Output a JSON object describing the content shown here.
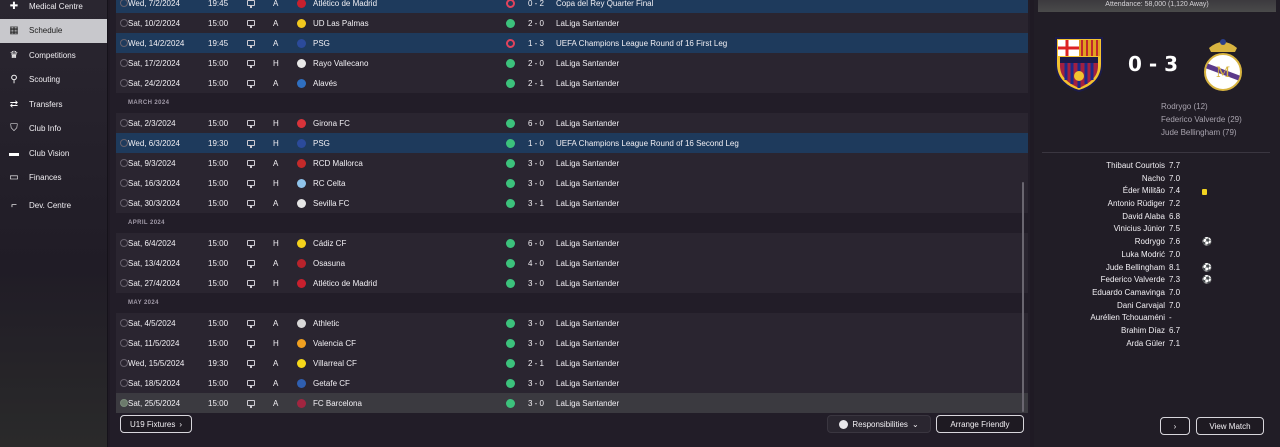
{
  "sidebar": {
    "items": [
      {
        "label": "Medical Centre",
        "icon": "medical-plus-icon",
        "active": false
      },
      {
        "label": "Schedule",
        "icon": "calendar-icon",
        "active": true
      },
      {
        "label": "Competitions",
        "icon": "trophy-icon",
        "active": false
      },
      {
        "label": "Scouting",
        "icon": "magnifier-icon",
        "active": false
      },
      {
        "label": "Transfers",
        "icon": "transfer-arrows-icon",
        "active": false
      },
      {
        "label": "Club Info",
        "icon": "shield-icon",
        "active": false
      },
      {
        "label": "Club Vision",
        "icon": "briefcase-icon",
        "active": false
      },
      {
        "label": "Finances",
        "icon": "banknote-icon",
        "active": false
      },
      {
        "label": "Dev. Centre",
        "icon": "boot-icon",
        "active": false
      }
    ]
  },
  "fixtures": [
    {
      "type": "match",
      "date": "Wed, 7/2/2024",
      "time": "19:45",
      "ha": "A",
      "opponent": "Atlético de Madrid",
      "crest_color": "#c8202e",
      "result": "loss",
      "score": "0 - 2",
      "competition": "Copa del Rey Quarter Final",
      "style": "hl"
    },
    {
      "type": "match",
      "date": "Sat, 10/2/2024",
      "time": "15:00",
      "ha": "A",
      "opponent": "UD Las Palmas",
      "crest_color": "#f2c81e",
      "result": "win",
      "score": "2 - 0",
      "competition": "LaLiga Santander",
      "style": "shade"
    },
    {
      "type": "match",
      "date": "Wed, 14/2/2024",
      "time": "19:45",
      "ha": "A",
      "opponent": "PSG",
      "crest_color": "#2b4a9a",
      "result": "loss",
      "score": "1 - 3",
      "competition": "UEFA Champions League Round of 16  First Leg",
      "style": "hl"
    },
    {
      "type": "match",
      "date": "Sat, 17/2/2024",
      "time": "15:00",
      "ha": "H",
      "opponent": "Rayo Vallecano",
      "crest_color": "#e8e8e8",
      "result": "win",
      "score": "2 - 0",
      "competition": "LaLiga Santander",
      "style": "shade"
    },
    {
      "type": "match",
      "date": "Sat, 24/2/2024",
      "time": "15:00",
      "ha": "A",
      "opponent": "Alavés",
      "crest_color": "#2f6fc0",
      "result": "win",
      "score": "2 - 1",
      "competition": "LaLiga Santander",
      "style": "shade"
    },
    {
      "type": "month",
      "label": "MARCH 2024"
    },
    {
      "type": "match",
      "date": "Sat, 2/3/2024",
      "time": "15:00",
      "ha": "H",
      "opponent": "Girona FC",
      "crest_color": "#d8333a",
      "result": "win",
      "score": "6 - 0",
      "competition": "LaLiga Santander",
      "style": "shade"
    },
    {
      "type": "match",
      "date": "Wed, 6/3/2024",
      "time": "19:30",
      "ha": "H",
      "opponent": "PSG",
      "crest_color": "#2b4a9a",
      "result": "win",
      "score": "1 - 0",
      "competition": "UEFA Champions League Round of 16  Second Leg",
      "style": "hl"
    },
    {
      "type": "match",
      "date": "Sat, 9/3/2024",
      "time": "15:00",
      "ha": "A",
      "opponent": "RCD Mallorca",
      "crest_color": "#c42a2a",
      "result": "win",
      "score": "3 - 0",
      "competition": "LaLiga Santander",
      "style": "shade"
    },
    {
      "type": "match",
      "date": "Sat, 16/3/2024",
      "time": "15:00",
      "ha": "H",
      "opponent": "RC Celta",
      "crest_color": "#8fc3ea",
      "result": "win",
      "score": "3 - 0",
      "competition": "LaLiga Santander",
      "style": "shade"
    },
    {
      "type": "match",
      "date": "Sat, 30/3/2024",
      "time": "15:00",
      "ha": "A",
      "opponent": "Sevilla FC",
      "crest_color": "#e6e6e6",
      "result": "win",
      "score": "3 - 1",
      "competition": "LaLiga Santander",
      "style": "shade"
    },
    {
      "type": "month",
      "label": "APRIL 2024"
    },
    {
      "type": "match",
      "date": "Sat, 6/4/2024",
      "time": "15:00",
      "ha": "H",
      "opponent": "Cádiz CF",
      "crest_color": "#f4d21c",
      "result": "win",
      "score": "6 - 0",
      "competition": "LaLiga Santander",
      "style": "shade"
    },
    {
      "type": "match",
      "date": "Sat, 13/4/2024",
      "time": "15:00",
      "ha": "A",
      "opponent": "Osasuna",
      "crest_color": "#b8232c",
      "result": "win",
      "score": "4 - 0",
      "competition": "LaLiga Santander",
      "style": "shade"
    },
    {
      "type": "match",
      "date": "Sat, 27/4/2024",
      "time": "15:00",
      "ha": "H",
      "opponent": "Atlético de Madrid",
      "crest_color": "#c8202e",
      "result": "win",
      "score": "3 - 0",
      "competition": "LaLiga Santander",
      "style": "shade"
    },
    {
      "type": "month",
      "label": "MAY 2024"
    },
    {
      "type": "match",
      "date": "Sat, 4/5/2024",
      "time": "15:00",
      "ha": "A",
      "opponent": "Athletic",
      "crest_color": "#d8d8d8",
      "result": "win",
      "score": "3 - 0",
      "competition": "LaLiga Santander",
      "style": "shade"
    },
    {
      "type": "match",
      "date": "Sat, 11/5/2024",
      "time": "15:00",
      "ha": "H",
      "opponent": "Valencia CF",
      "crest_color": "#f0a020",
      "result": "win",
      "score": "3 - 0",
      "competition": "LaLiga Santander",
      "style": "shade"
    },
    {
      "type": "match",
      "date": "Wed, 15/5/2024",
      "time": "19:30",
      "ha": "A",
      "opponent": "Villarreal CF",
      "crest_color": "#f6d81a",
      "result": "win",
      "score": "2 - 1",
      "competition": "LaLiga Santander",
      "style": "shade"
    },
    {
      "type": "match",
      "date": "Sat, 18/5/2024",
      "time": "15:00",
      "ha": "A",
      "opponent": "Getafe CF",
      "crest_color": "#2f5fb0",
      "result": "win",
      "score": "3 - 0",
      "competition": "LaLiga Santander",
      "style": "shade"
    },
    {
      "type": "match",
      "date": "Sat, 25/5/2024",
      "time": "15:00",
      "ha": "A",
      "opponent": "FC Barcelona",
      "crest_color": "#a12540",
      "result": "win",
      "score": "3 - 0",
      "competition": "LaLiga Santander",
      "style": "sel",
      "checked": true
    }
  ],
  "buttons": {
    "u19": "U19 Fixtures",
    "responsibilities": "Responsibilities",
    "arrange": "Arrange Friendly",
    "next": "›",
    "view_match": "View Match"
  },
  "match_panel": {
    "attendance": "Attendance: 58,000 (1,120 Away)",
    "score": "0 - 3",
    "scorers": [
      "Rodrygo (12)",
      "Federico Valverde (29)",
      "Jude Bellingham (79)"
    ],
    "players": [
      {
        "name": "Thibaut Courtois",
        "rating": "7.7",
        "badge": ""
      },
      {
        "name": "Nacho",
        "rating": "7.0",
        "badge": ""
      },
      {
        "name": "Éder Militão",
        "rating": "7.4",
        "badge": "yellow"
      },
      {
        "name": "Antonio Rüdiger",
        "rating": "7.2",
        "badge": ""
      },
      {
        "name": "David Alaba",
        "rating": "6.8",
        "badge": ""
      },
      {
        "name": "Vinicius Júnior",
        "rating": "7.5",
        "badge": ""
      },
      {
        "name": "Rodrygo",
        "rating": "7.6",
        "badge": "goal"
      },
      {
        "name": "Luka Modrić",
        "rating": "7.0",
        "badge": ""
      },
      {
        "name": "Jude Bellingham",
        "rating": "8.1",
        "badge": "goal"
      },
      {
        "name": "Federico Valverde",
        "rating": "7.3",
        "badge": "goal"
      },
      {
        "name": "Eduardo Camavinga",
        "rating": "7.0",
        "badge": ""
      },
      {
        "name": "Dani Carvajal",
        "rating": "7.0",
        "badge": ""
      },
      {
        "name": "Aurélien Tchouaméni",
        "rating": "-",
        "badge": ""
      },
      {
        "name": "Brahim Díaz",
        "rating": "6.7",
        "badge": ""
      },
      {
        "name": "Arda Güler",
        "rating": "7.1",
        "badge": ""
      }
    ]
  }
}
